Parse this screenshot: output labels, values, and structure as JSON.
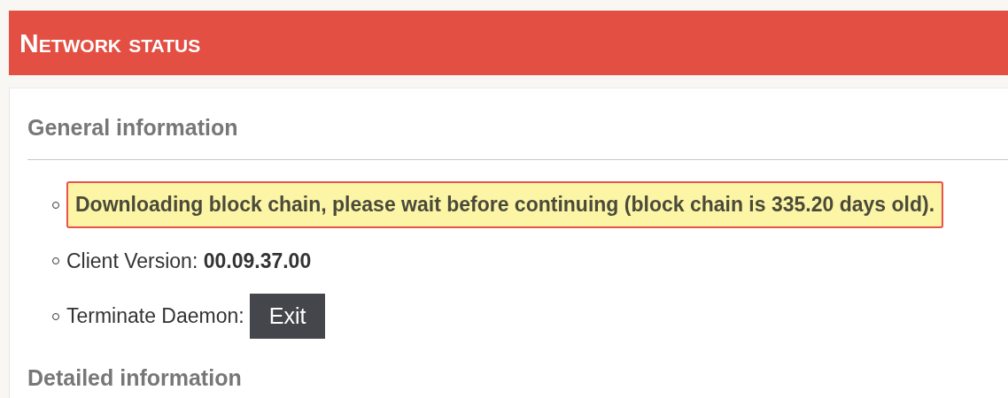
{
  "header": {
    "title": "Network status"
  },
  "sections": [
    {
      "title": "General information",
      "items": [
        {
          "kind": "alert",
          "text": "Downloading block chain, please wait before continuing (block chain is 335.20 days old)."
        },
        {
          "kind": "value",
          "label": "Client Version:",
          "value": "00.09.37.00"
        },
        {
          "kind": "button",
          "label": "Terminate Daemon:",
          "button": "Exit"
        }
      ]
    },
    {
      "title": "Detailed information"
    }
  ]
}
